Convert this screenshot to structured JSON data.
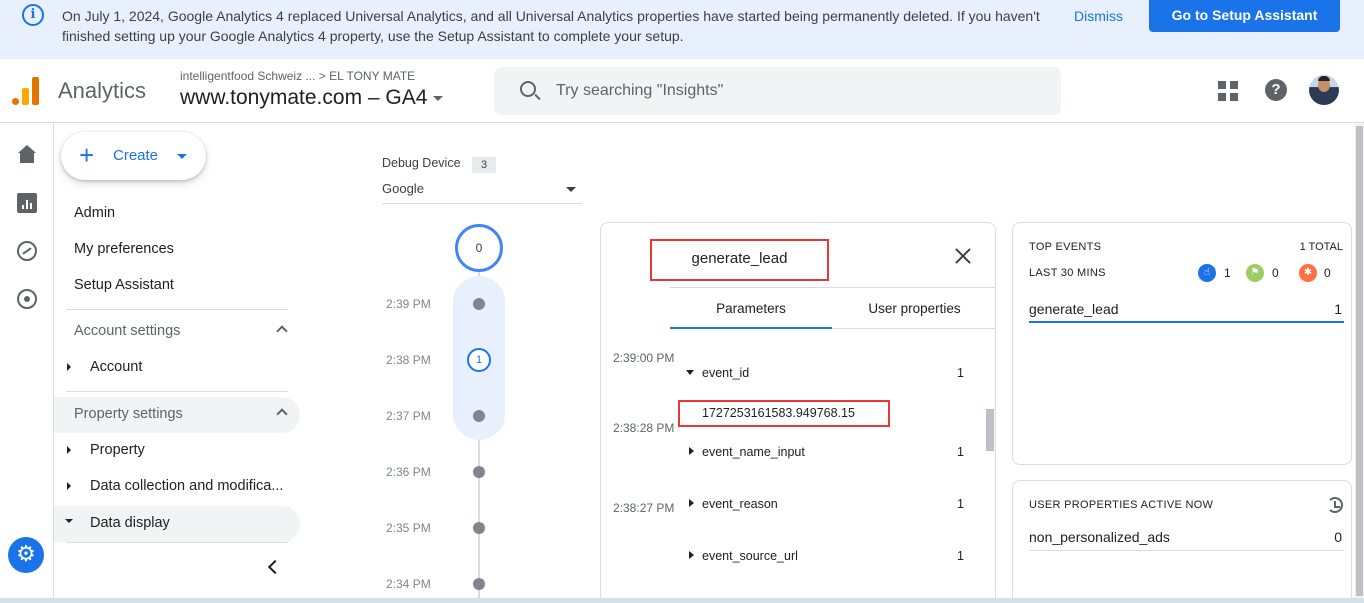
{
  "banner": {
    "message": "On July 1, 2024, Google Analytics 4 replaced Universal Analytics, and all Universal Analytics properties have started being permanently deleted. If you haven't finished setting up your Google Analytics 4 property, use the Setup Assistant to complete your setup.",
    "dismiss_label": "Dismiss",
    "setup_label": "Go to Setup Assistant",
    "info_icon": "info-icon"
  },
  "header": {
    "app_name": "Analytics",
    "breadcrumb_account": "intelligentfood Schweiz ...",
    "breadcrumb_separator": ">",
    "breadcrumb_property": "EL TONY MATE",
    "property_name": "www.tonymate.com",
    "property_suffix": "– GA4",
    "search_placeholder": "Try searching \"Insights\"",
    "icons": [
      "search-icon",
      "apps-icon",
      "help-icon",
      "avatar"
    ]
  },
  "rail": {
    "icons": [
      "home-icon",
      "reports-icon",
      "explore-icon",
      "advertising-icon",
      "settings-icon"
    ]
  },
  "nav": {
    "create_label": "Create",
    "links": [
      "Admin",
      "My preferences",
      "Setup Assistant"
    ],
    "account_settings": "Account settings",
    "account": "Account",
    "property_settings": "Property settings",
    "property": "Property",
    "data_collection": "Data collection and modifica...",
    "data_display": "Data display"
  },
  "debug": {
    "device_label": "Debug Device",
    "device_count": "3",
    "device_value": "Google",
    "top_count": "0",
    "times": [
      "2:39 PM",
      "2:38 PM",
      "2:37 PM",
      "2:36 PM",
      "2:35 PM",
      "2:34 PM"
    ],
    "marker_count": "1"
  },
  "event": {
    "name": "generate_lead",
    "tab_parameters": "Parameters",
    "tab_user_properties": "User properties",
    "stream_times": [
      "2:39:00 PM",
      "2:38:28 PM",
      "2:38:27 PM"
    ],
    "params": [
      {
        "name": "event_id",
        "count": "1"
      },
      {
        "name": "event_name_input",
        "count": "1"
      },
      {
        "name": "event_reason",
        "count": "1"
      },
      {
        "name": "event_source_url",
        "count": "1"
      }
    ],
    "event_id_value": "1727253161583.949768.15"
  },
  "top_events": {
    "title": "TOP EVENTS",
    "total": "1 TOTAL",
    "period": "LAST 30 MINS",
    "counts": {
      "events": "1",
      "conversions": "0",
      "errors": "0"
    },
    "colors": {
      "events": "#1a73e8",
      "conversions": "#9ccc65",
      "errors": "#ff7043"
    },
    "rows": [
      {
        "name": "generate_lead",
        "count": "1"
      }
    ]
  },
  "user_props": {
    "title": "USER PROPERTIES ACTIVE NOW",
    "rows": [
      {
        "name": "non_personalized_ads",
        "value": "0"
      }
    ]
  }
}
